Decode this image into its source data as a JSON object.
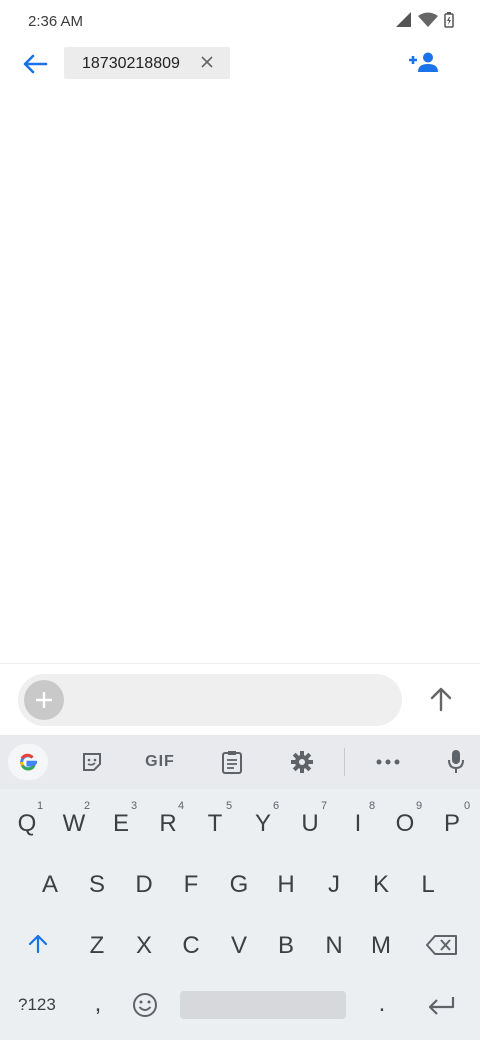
{
  "status": {
    "time": "2:36 AM"
  },
  "header": {
    "recipient": "18730218809"
  },
  "compose": {
    "placeholder": ""
  },
  "keyboard": {
    "toolbar": {
      "gif_label": "GIF"
    },
    "row1": [
      "Q",
      "W",
      "E",
      "R",
      "T",
      "Y",
      "U",
      "I",
      "O",
      "P"
    ],
    "row1_hints": [
      "1",
      "2",
      "3",
      "4",
      "5",
      "6",
      "7",
      "8",
      "9",
      "0"
    ],
    "row2": [
      "A",
      "S",
      "D",
      "F",
      "G",
      "H",
      "J",
      "K",
      "L"
    ],
    "row3": [
      "Z",
      "X",
      "C",
      "V",
      "B",
      "N",
      "M"
    ],
    "bottom": {
      "symbols_label": "?123",
      "comma": ",",
      "period": "."
    }
  },
  "colors": {
    "accent": "#1a73e8",
    "keyboard_bg": "#eceff1"
  }
}
